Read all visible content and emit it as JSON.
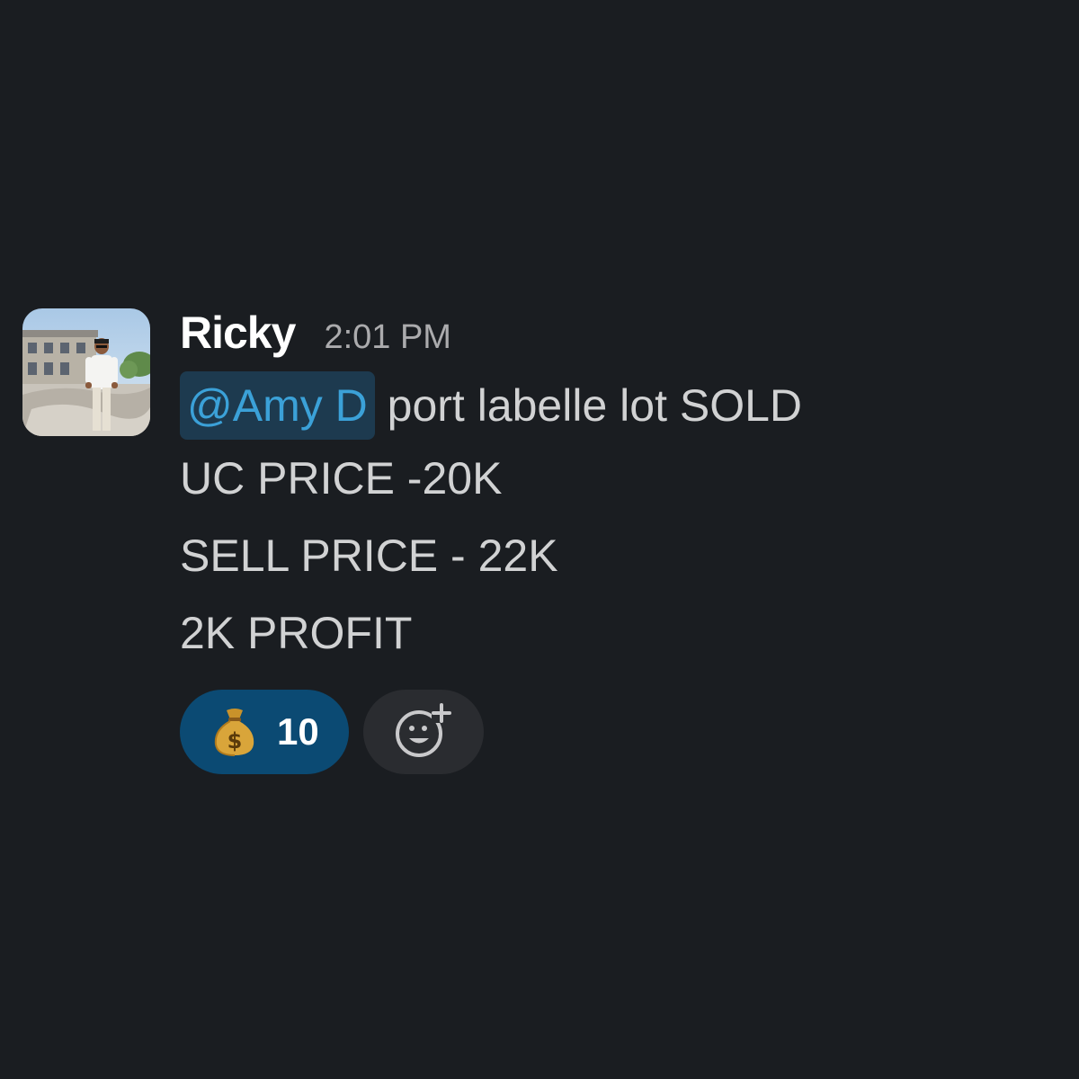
{
  "message": {
    "author": "Ricky",
    "timestamp": "2:01 PM",
    "mention": "@Amy D",
    "first_line_rest": " port labelle lot SOLD",
    "lines": [
      "UC PRICE -20K",
      "SELL PRICE - 22K",
      "2K PROFIT"
    ],
    "reactions": [
      {
        "emoji": "money-bag-icon",
        "count": "10"
      }
    ],
    "add_reaction_icon": "add-reaction-icon"
  },
  "colors": {
    "background": "#1a1d21",
    "mention_bg": "#1d3a4f",
    "mention_text": "#3ba1d8",
    "reaction_bg": "#0b4a73"
  }
}
